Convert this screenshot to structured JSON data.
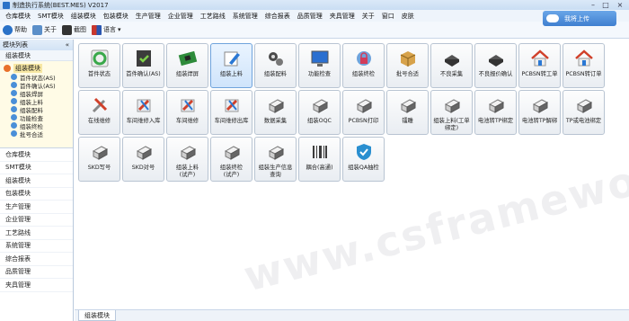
{
  "window": {
    "title": "制造执行系统(BEST.MES) V2017"
  },
  "menu": [
    "仓库模块",
    "SMT模块",
    "组装模块",
    "包装模块",
    "生产管理",
    "企业管理",
    "工艺路线",
    "系统管理",
    "综合报表",
    "品质管理",
    "夹具管理",
    "关于",
    "窗口",
    "皮肤"
  ],
  "toolbar": {
    "help": "帮助",
    "about": "关于",
    "screenshot": "截图",
    "language": "语言"
  },
  "sync_button": "我将上传",
  "sidebar": {
    "header": "模块列表",
    "header_pin": "«",
    "section": "组装模块",
    "tree_root": "组装模块",
    "tree_nodes": [
      "首件状态(AS)",
      "首件确认(AS)",
      "组装焊屏",
      "组装上料",
      "组装配料",
      "功能检查",
      "组装终检",
      "批号合适"
    ],
    "modules": [
      "仓库模块",
      "SMT模块",
      "组装模块",
      "包装模块",
      "生产管理",
      "企业管理",
      "工艺路线",
      "系统管理",
      "综合报表",
      "品质管理",
      "夹具管理"
    ]
  },
  "tiles": [
    {
      "label": "首件状态",
      "icon": "recycle-icon",
      "color": "#3aa84a"
    },
    {
      "label": "首件确认(AS)",
      "icon": "film-check-icon",
      "color": "#3c3c3c"
    },
    {
      "label": "组装焊屏",
      "icon": "circuit-board-icon",
      "color": "#2e8b3a"
    },
    {
      "label": "组装上料",
      "icon": "pencil-edit-icon",
      "color": "#2a78d4"
    },
    {
      "label": "组装配料",
      "icon": "gears-icon",
      "color": "#4a4a4a"
    },
    {
      "label": "功能检查",
      "icon": "monitor-icon",
      "color": "#2a6fd0"
    },
    {
      "label": "组装终检",
      "icon": "lock-icon",
      "color": "#d23c5a"
    },
    {
      "label": "批号合适",
      "icon": "box-icon",
      "color": "#d7a24a"
    },
    {
      "label": "不良采集",
      "icon": "chip-icon",
      "color": "#555555"
    },
    {
      "label": "不良报价确认",
      "icon": "chip-icon",
      "color": "#555555"
    },
    {
      "label": "PCBSN转工单",
      "icon": "house-icon",
      "color": "#d0402a"
    },
    {
      "label": "PCBSN转订单",
      "icon": "house-icon",
      "color": "#d0402a"
    },
    {
      "label": "在线维修",
      "icon": "tools-icon",
      "color": "#d0402a"
    },
    {
      "label": "车间维修入库",
      "icon": "wrench-box-icon",
      "color": "#d0402a"
    },
    {
      "label": "车间维修",
      "icon": "wrench-box-icon",
      "color": "#d0402a"
    },
    {
      "label": "车间维修出库",
      "icon": "wrench-box-icon",
      "color": "#d0402a"
    },
    {
      "label": "数据采集",
      "icon": "scanner-icon",
      "color": "#666666"
    },
    {
      "label": "组装OQC",
      "icon": "scanner-icon",
      "color": "#666666"
    },
    {
      "label": "PCBSN打印",
      "icon": "scanner-icon",
      "color": "#666666"
    },
    {
      "label": "镭雕",
      "icon": "scanner-icon",
      "color": "#666666"
    },
    {
      "label": "组装上料(工单\n绑定)",
      "icon": "scanner-icon",
      "color": "#666666"
    },
    {
      "label": "电池转TP绑定",
      "icon": "scanner-icon",
      "color": "#666666"
    },
    {
      "label": "电池转TP解绑",
      "icon": "scanner-icon",
      "color": "#666666"
    },
    {
      "label": "TP或电池绑定",
      "icon": "scanner-icon",
      "color": "#666666"
    },
    {
      "label": "SKD写号",
      "icon": "scanner-icon",
      "color": "#666666"
    },
    {
      "label": "SKD对号",
      "icon": "scanner-icon",
      "color": "#666666"
    },
    {
      "label": "组装上料\n(试产)",
      "icon": "scanner-icon",
      "color": "#666666"
    },
    {
      "label": "组装终检\n(试产)",
      "icon": "scanner-icon",
      "color": "#666666"
    },
    {
      "label": "组装生产信息\n查询",
      "icon": "scanner-icon",
      "color": "#666666"
    },
    {
      "label": "耦合(高通)",
      "icon": "barcode-icon",
      "color": "#3c3c3c"
    },
    {
      "label": "组装QA抽检",
      "icon": "shield-check-icon",
      "color": "#2a8fd0"
    }
  ],
  "bottom_tab": "组装模块",
  "watermark": "www.csframework.com"
}
